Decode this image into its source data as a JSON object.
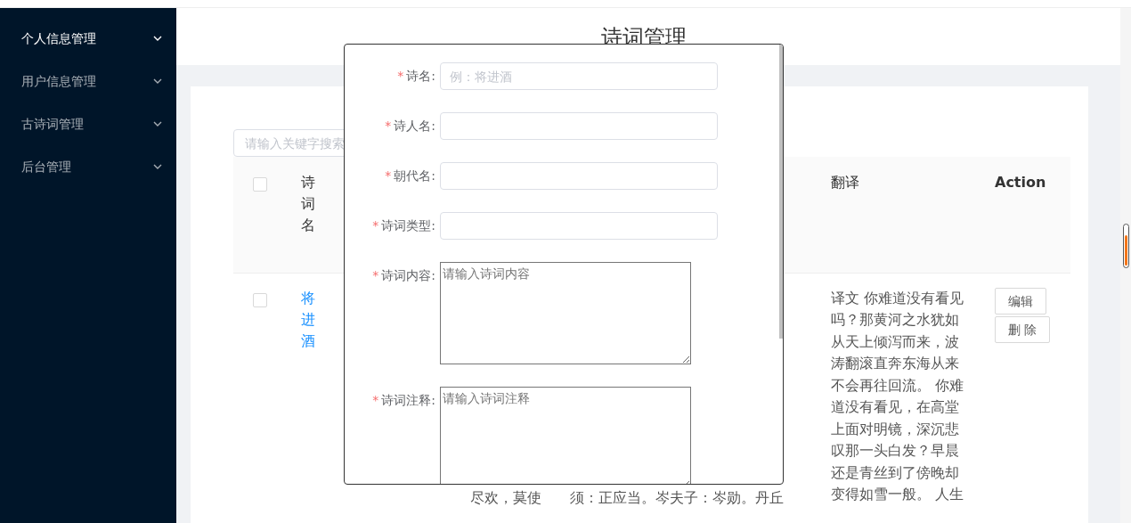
{
  "sidebar": {
    "items": [
      {
        "label": "个人信息管理",
        "selected": true
      },
      {
        "label": "用户信息管理",
        "selected": false
      },
      {
        "label": "古诗词管理",
        "selected": false
      },
      {
        "label": "后台管理",
        "selected": false
      }
    ]
  },
  "page_title": "诗词管理",
  "search": {
    "placeholder": "请输入关键字搜索"
  },
  "table": {
    "header_checked": false,
    "columns": [
      "诗词名",
      "翻译",
      "Action"
    ],
    "rows": [
      {
        "checked": false,
        "title": "将进酒",
        "column_3": "尽欢，莫使",
        "column_4": "须：正应当。岑夫子：岑勋。丹丘",
        "translation": [
          "译文 你难道没有看见",
          "吗？那黄河之水犹如",
          "从天上倾泻而来，波",
          "涛翻滚直奔东海从来",
          "不会再往回流。 你难",
          "道没有看见，在高堂",
          "上面对明镜，深沉悲",
          "叹那一头白发？早晨",
          "还是青丝到了傍晚却",
          "变得如雪一般。 人生"
        ],
        "actions": [
          "编辑",
          "删 除"
        ]
      }
    ]
  },
  "modal": {
    "fields": [
      {
        "kind": "input",
        "required_mark": "*",
        "label": "诗名:",
        "placeholder": "例：将进酒"
      },
      {
        "kind": "input",
        "required_mark": "*",
        "label": "诗人名:"
      },
      {
        "kind": "input",
        "required_mark": "*",
        "label": "朝代名:"
      },
      {
        "kind": "input",
        "required_mark": "*",
        "label": "诗词类型:"
      },
      {
        "kind": "textarea",
        "required_mark": "*",
        "label": "诗词内容:",
        "placeholder": "请输入诗词内容"
      },
      {
        "kind": "textarea",
        "required_mark": "*",
        "label": "诗词注释:",
        "placeholder": "请输入诗词注释"
      }
    ]
  }
}
